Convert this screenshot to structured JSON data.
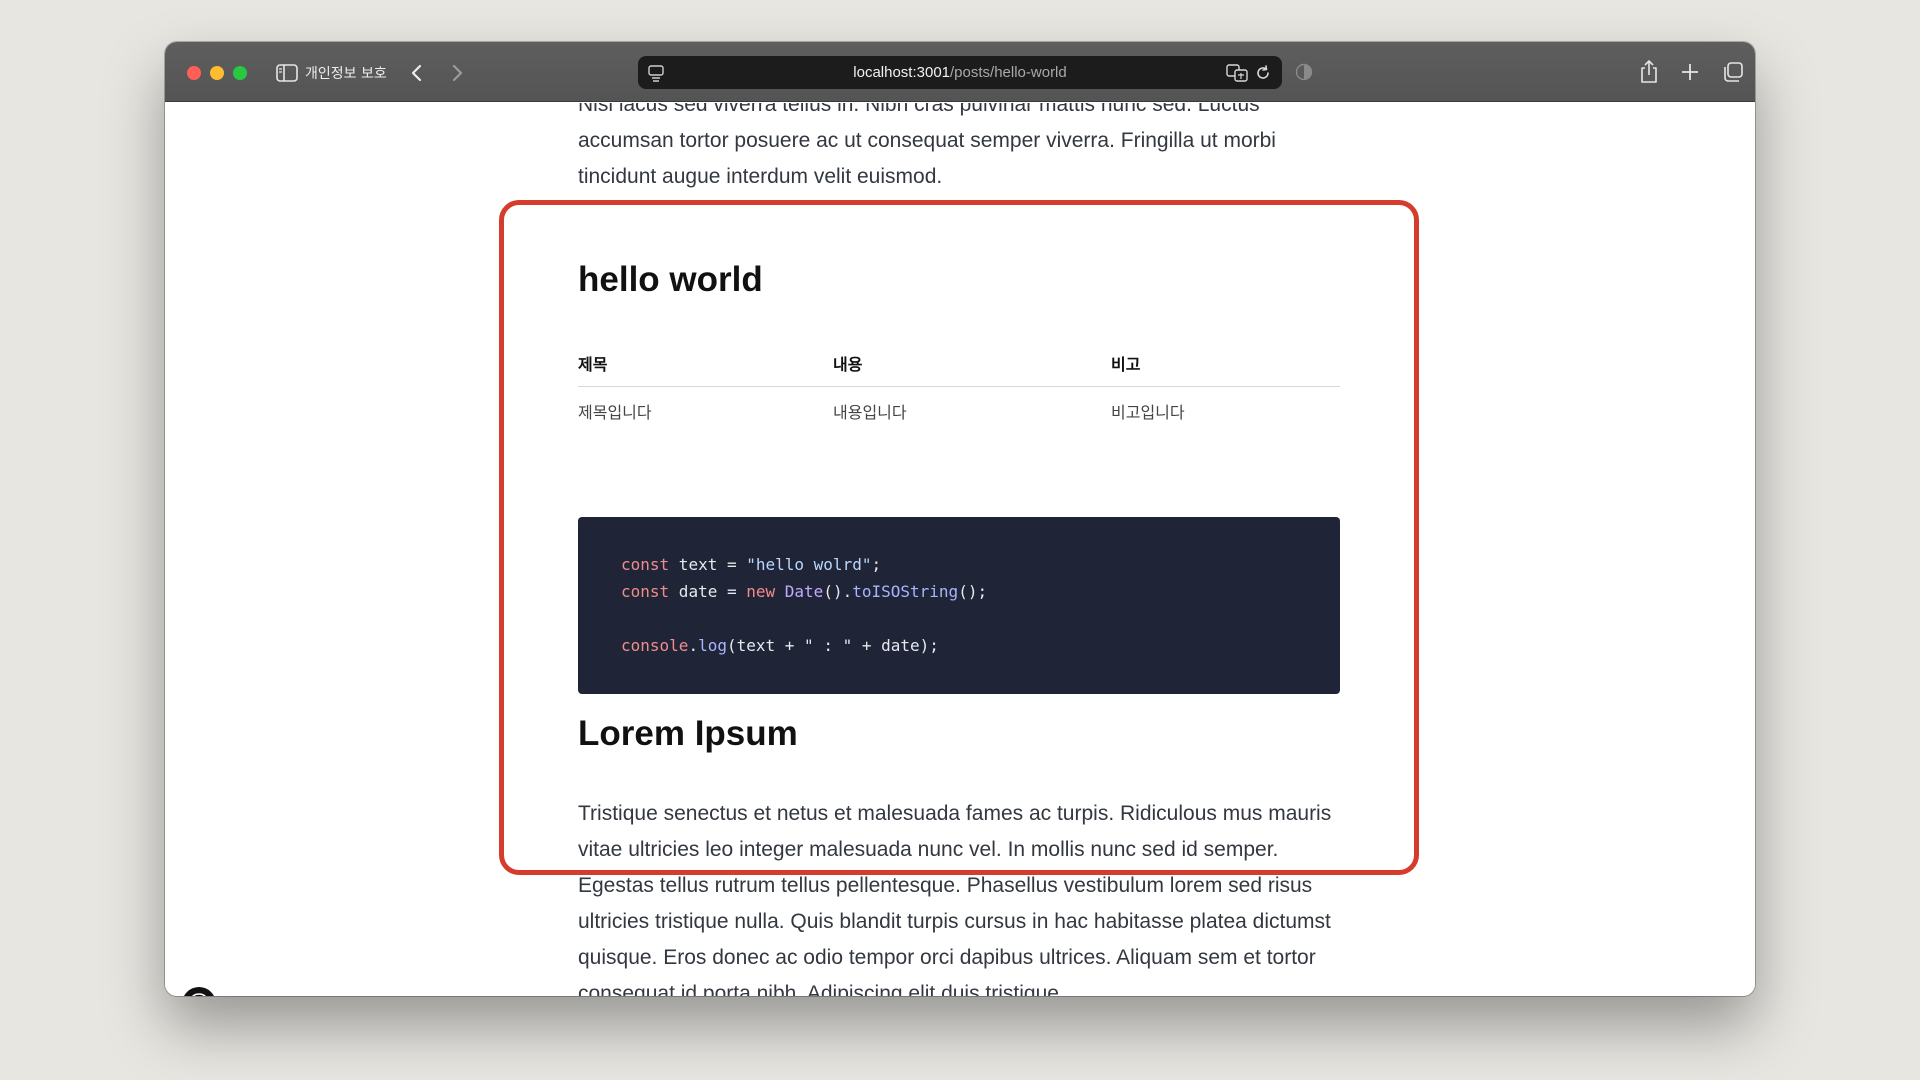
{
  "browser": {
    "privacy_label": "개인정보 보호",
    "url_host": "localhost:3001",
    "url_path": "/posts/hello-world"
  },
  "article": {
    "intro_paragraph": "Nisl lacus sed viverra tellus in. Nibh cras pulvinar mattis nunc sed. Luctus accumsan tortor posuere ac ut consequat semper viverra. Fringilla ut morbi tincidunt augue interdum velit euismod.",
    "heading_hello": "hello world",
    "table": {
      "headers": [
        "제목",
        "내용",
        "비고"
      ],
      "row": [
        "제목입니다",
        "내용입니다",
        "비고입니다"
      ]
    },
    "code": {
      "line1": {
        "kw": "const",
        "rest1": " text = ",
        "str": "\"hello wolrd\"",
        "end": ";"
      },
      "line2": {
        "kw": "const",
        "rest1": " date = ",
        "kw2": "new",
        "fn": "Date",
        "mid": "().",
        "fn2": "toISOString",
        "end": "();"
      },
      "line3": {
        "fn": "console",
        "dot": ".",
        "fn2": "log",
        "rest": "(text + \" : \" + date);"
      }
    },
    "heading_lorem": "Lorem Ipsum",
    "body_paragraph": "Tristique senectus et netus et malesuada fames ac turpis. Ridiculous mus mauris vitae ultricies leo integer malesuada nunc vel. In mollis nunc sed id semper. Egestas tellus rutrum tellus pellentesque. Phasellus vestibulum lorem sed risus ultricies tristique nulla. Quis blandit turpis cursus in hac habitasse platea dictumst quisque. Eros donec ac odio tempor orci dapibus ultrices. Aliquam sem et tortor consequat id porta nibh. Adipiscing elit duis tristique"
  },
  "colors": {
    "highlight": "#d63c2b",
    "code_bg": "#1f2537"
  },
  "icons": [
    "sidebar-icon",
    "chevron-left-icon",
    "chevron-right-icon",
    "page-menu-icon",
    "translate-icon",
    "reload-icon",
    "shield-icon",
    "share-icon",
    "plus-icon",
    "tabs-icon",
    "bolt-icon"
  ]
}
